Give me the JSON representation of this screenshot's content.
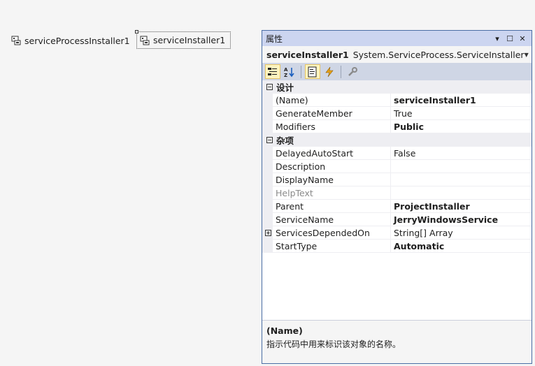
{
  "designer": {
    "components": [
      {
        "label": "serviceProcessInstaller1",
        "icon": "service-component-icon"
      },
      {
        "label": "serviceInstaller1",
        "icon": "service-component-icon",
        "selected": true
      }
    ]
  },
  "properties_panel": {
    "title": "属性",
    "title_buttons": {
      "dropdown": "▾",
      "maximize": "☐",
      "close": "✕"
    },
    "object_name": "serviceInstaller1",
    "object_type": "System.ServiceProcess.ServiceInstaller",
    "toolbar": {
      "buttons": [
        "categorized-icon",
        "alphabetical-icon",
        "properties-icon",
        "events-icon",
        "property-pages-icon"
      ],
      "active": [
        "categorized-icon",
        "properties-icon"
      ]
    },
    "categories": [
      {
        "label": "设计",
        "rows": [
          {
            "name": "(Name)",
            "value": "serviceInstaller1",
            "bold": true
          },
          {
            "name": "GenerateMember",
            "value": "True",
            "bold": false
          },
          {
            "name": "Modifiers",
            "value": "Public",
            "bold": true
          }
        ]
      },
      {
        "label": "杂项",
        "rows": [
          {
            "name": "DelayedAutoStart",
            "value": "False",
            "bold": false
          },
          {
            "name": "Description",
            "value": "",
            "bold": false
          },
          {
            "name": "DisplayName",
            "value": "",
            "bold": false
          },
          {
            "name": "HelpText",
            "value": "",
            "bold": false,
            "disabled": true
          },
          {
            "name": "Parent",
            "value": "ProjectInstaller",
            "bold": true
          },
          {
            "name": "ServiceName",
            "value": "JerryWindowsService",
            "bold": true
          },
          {
            "name": "ServicesDependedOn",
            "value": "String[] Array",
            "bold": false,
            "expandable": true
          },
          {
            "name": "StartType",
            "value": "Automatic",
            "bold": true
          }
        ]
      }
    ],
    "description": {
      "title": "(Name)",
      "text": "指示代码中用来标识该对象的名称。"
    },
    "colors": {
      "title_bar": "#ccd5f0",
      "toolbar": "#cfd6e5",
      "border": "#4a6ea5",
      "category_bg": "#eeeef2"
    }
  }
}
